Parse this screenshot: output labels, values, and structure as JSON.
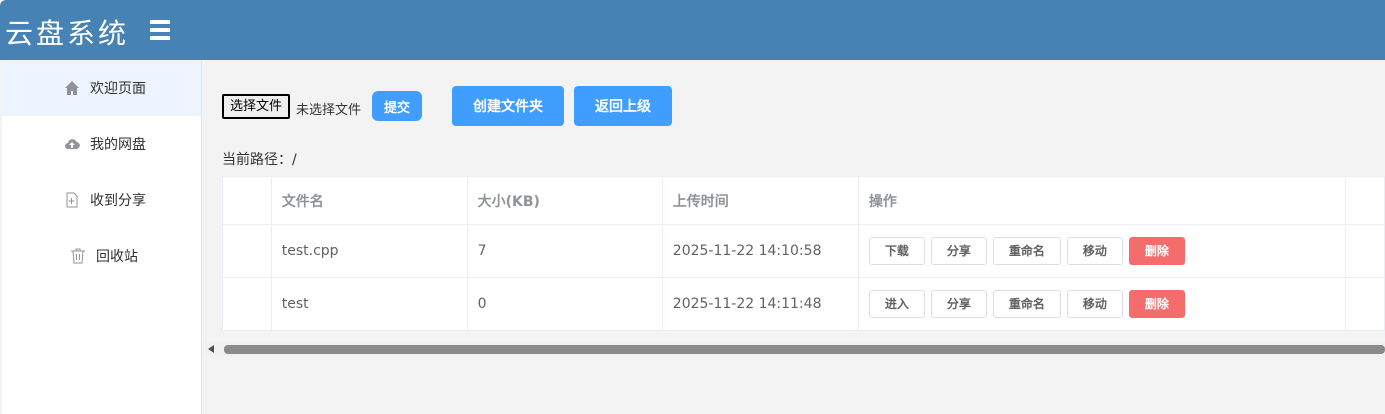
{
  "header": {
    "title": "云盘系统"
  },
  "sidebar": {
    "items": [
      {
        "label": "欢迎页面",
        "icon": "home-icon"
      },
      {
        "label": "我的网盘",
        "icon": "cloud-upload-icon"
      },
      {
        "label": "收到分享",
        "icon": "document-add-icon"
      },
      {
        "label": "回收站",
        "icon": "trash-icon"
      }
    ]
  },
  "toolbar": {
    "choose_file": "选择文件",
    "no_file": "未选择文件",
    "submit": "提交",
    "create_folder": "创建文件夹",
    "go_up": "返回上级"
  },
  "path": {
    "label": "当前路径：",
    "value": "/"
  },
  "table": {
    "headers": [
      "文件名",
      "大小(KB)",
      "上传时间",
      "操作"
    ],
    "rows": [
      {
        "name": "test.cpp",
        "size": "7",
        "time": "2025-11-22 14:10:58",
        "actions": [
          "下载",
          "分享",
          "重命名",
          "移动",
          "删除"
        ]
      },
      {
        "name": "test",
        "size": "0",
        "time": "2025-11-22 14:11:48",
        "actions": [
          "进入",
          "分享",
          "重命名",
          "移动",
          "删除"
        ]
      }
    ]
  },
  "colors": {
    "header": "#4682b4",
    "primary": "#409eff",
    "danger": "#f56c6c"
  }
}
